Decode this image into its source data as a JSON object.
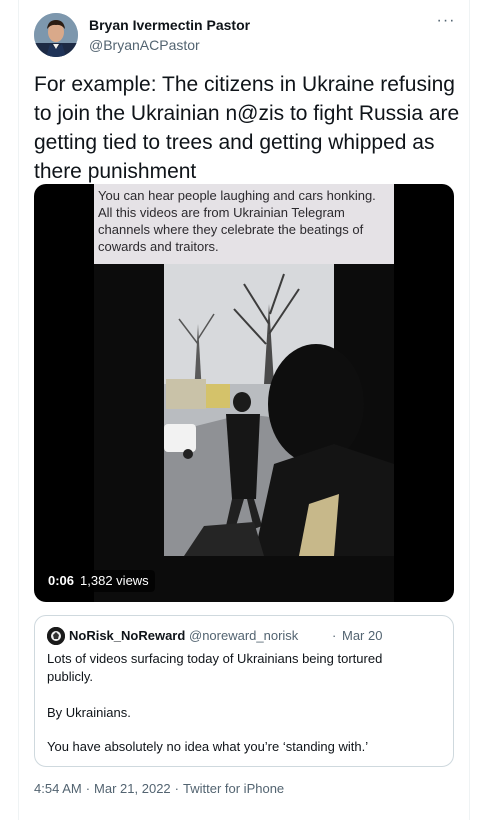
{
  "author": {
    "name": "Bryan Ivermectin Pastor",
    "handle": "@BryanACPastor"
  },
  "more_icon": "···",
  "tweet": {
    "text": "For example: The citizens in Ukraine refusing to join the Ukrainian n@zis to fight Russia are getting tied to trees and getting whipped as there punishment"
  },
  "video": {
    "caption": "You can hear people laughing and cars honking. All this videos are from Ukrainian Telegram channels where they celebrate the beatings of cowards and traitors.",
    "time": "0:06",
    "views": "1,382 views"
  },
  "quoted": {
    "name": "NoRisk_NoReward",
    "handle": "@noreward_norisk",
    "dot": "·",
    "date": "Mar 20",
    "paragraphs": [
      "Lots of videos surfacing today of Ukrainians being tortured publicly.",
      "By Ukrainians.",
      "You have absolutely no idea what you’re ‘standing with.’"
    ]
  },
  "footer": {
    "time": "4:54 AM",
    "sep1": "·",
    "date": "Mar 21, 2022",
    "sep2": "·",
    "source": "Twitter for iPhone"
  },
  "colors": {
    "text_primary": "#0f1419",
    "text_secondary": "#536471",
    "border": "#cfd9de"
  }
}
